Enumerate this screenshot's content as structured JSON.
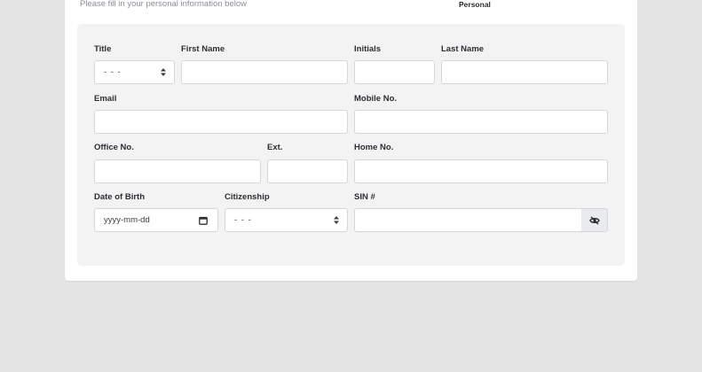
{
  "header": {
    "subtitle": "Please fill in your personal information below",
    "step_label": "Personal"
  },
  "form": {
    "title": {
      "label": "Title",
      "value": "- - -"
    },
    "first_name": {
      "label": "First Name",
      "value": ""
    },
    "initials": {
      "label": "Initials",
      "value": ""
    },
    "last_name": {
      "label": "Last Name",
      "value": ""
    },
    "email": {
      "label": "Email",
      "value": ""
    },
    "mobile": {
      "label": "Mobile No.",
      "value": ""
    },
    "office": {
      "label": "Office No.",
      "value": ""
    },
    "ext": {
      "label": "Ext.",
      "value": ""
    },
    "home": {
      "label": "Home No.",
      "value": ""
    },
    "dob": {
      "label": "Date of Birth",
      "placeholder": "yyyy-mm-dd"
    },
    "citizenship": {
      "label": "Citizenship",
      "value": "- - -"
    },
    "sin": {
      "label": "SIN #",
      "value": ""
    }
  },
  "icons": {
    "caret": "sort-caret-icon",
    "calendar": "calendar-icon",
    "visibility": "eye-slash-icon"
  }
}
